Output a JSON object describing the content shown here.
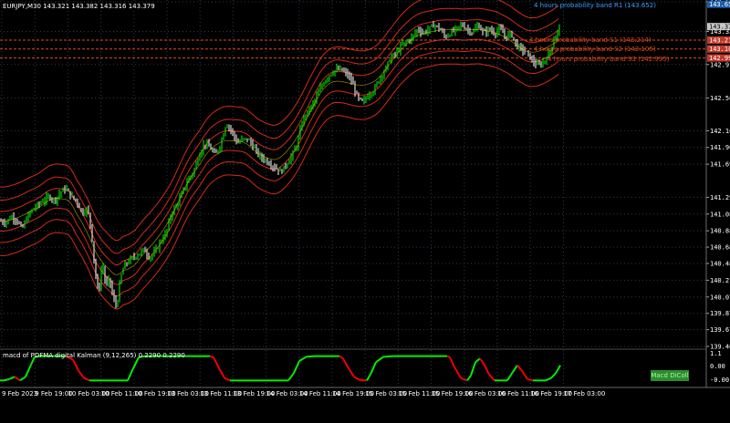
{
  "window": {
    "symbol_info": "EURJPY,M30  143.321 143.382 143.316 143.379",
    "indicator_info": "macd of PDFMA digital Kalman (9,12,265) 0.2290 0.2290",
    "macd_button": "Macd DiColl"
  },
  "colors": {
    "background": "#000000",
    "grid": "#2a3a4a",
    "bull_candle": "#00ff00",
    "bear_candle": "#ffffff",
    "kalman_line": "#ffe000",
    "band": "#d42a1a",
    "r1_text": "#3aa0ff",
    "s_text": "#e04a20",
    "macd_up": "#00ee00",
    "macd_down": "#ee0000",
    "macd_button_bg": "#2e8b2e"
  },
  "chart_data": [
    {
      "type": "candlestick",
      "title": "EURJPY,M30",
      "ylim": [
        139.465,
        143.682
      ],
      "price_ticks": [
        "143.682",
        "143.320",
        "142.915",
        "142.505",
        "142.105",
        "141.900",
        "141.695",
        "141.290",
        "141.085",
        "140.880",
        "140.680",
        "140.480",
        "140.275",
        "140.070",
        "139.870",
        "139.670",
        "139.465"
      ],
      "highlighted_price_labels": [
        {
          "label": "143.652",
          "kind": "r1"
        },
        {
          "label": "143.379",
          "kind": "current"
        },
        {
          "label": "143.214",
          "kind": "s"
        },
        {
          "label": "143.105",
          "kind": "s"
        },
        {
          "label": "142.995",
          "kind": "s"
        }
      ],
      "time_labels": [
        "9 Feb 2023",
        "9 Feb 19:00",
        "10 Feb 03:00",
        "10 Feb 11:00",
        "10 Feb 19:00",
        "13 Feb 03:00",
        "13 Feb 11:00",
        "13 Feb 19:00",
        "14 Feb 03:00",
        "14 Feb 11:00",
        "14 Feb 19:00",
        "15 Feb 03:00",
        "15 Feb 11:00",
        "15 Feb 19:00",
        "16 Feb 03:00",
        "16 Feb 11:00",
        "16 Feb 19:00",
        "17 Feb 03:00"
      ],
      "price_path": [
        [
          0,
          141.0
        ],
        [
          6,
          140.98
        ],
        [
          12,
          141.05
        ],
        [
          18,
          141.02
        ],
        [
          24,
          140.9
        ],
        [
          30,
          141.05
        ],
        [
          36,
          141.15
        ],
        [
          42,
          141.2
        ],
        [
          48,
          141.25
        ],
        [
          54,
          141.3
        ],
        [
          60,
          141.25
        ],
        [
          66,
          141.35
        ],
        [
          72,
          141.4
        ],
        [
          78,
          141.3
        ],
        [
          84,
          141.25
        ],
        [
          90,
          141.1
        ],
        [
          96,
          141.15
        ],
        [
          100,
          140.9
        ],
        [
          104,
          140.4
        ],
        [
          108,
          140.1
        ],
        [
          112,
          140.5
        ],
        [
          116,
          140.2
        ],
        [
          120,
          140.3
        ],
        [
          124,
          140.05
        ],
        [
          128,
          139.95
        ],
        [
          132,
          140.3
        ],
        [
          136,
          140.45
        ],
        [
          140,
          140.5
        ],
        [
          146,
          140.55
        ],
        [
          152,
          140.6
        ],
        [
          158,
          140.65
        ],
        [
          164,
          140.55
        ],
        [
          170,
          140.62
        ],
        [
          176,
          140.75
        ],
        [
          182,
          140.85
        ],
        [
          188,
          141.1
        ],
        [
          194,
          141.2
        ],
        [
          200,
          141.35
        ],
        [
          206,
          141.5
        ],
        [
          212,
          141.6
        ],
        [
          218,
          141.8
        ],
        [
          224,
          141.95
        ],
        [
          230,
          141.9
        ],
        [
          236,
          141.8
        ],
        [
          242,
          141.95
        ],
        [
          248,
          142.2
        ],
        [
          254,
          142.1
        ],
        [
          260,
          141.95
        ],
        [
          266,
          142.0
        ],
        [
          272,
          142.0
        ],
        [
          278,
          141.9
        ],
        [
          284,
          141.8
        ],
        [
          290,
          141.75
        ],
        [
          296,
          141.7
        ],
        [
          302,
          141.65
        ],
        [
          308,
          141.6
        ],
        [
          314,
          141.7
        ],
        [
          320,
          141.8
        ],
        [
          326,
          141.95
        ],
        [
          332,
          142.25
        ],
        [
          338,
          142.35
        ],
        [
          344,
          142.45
        ],
        [
          350,
          142.6
        ],
        [
          356,
          142.72
        ],
        [
          362,
          142.8
        ],
        [
          368,
          142.85
        ],
        [
          374,
          142.85
        ],
        [
          380,
          142.8
        ],
        [
          386,
          142.7
        ],
        [
          392,
          142.5
        ],
        [
          398,
          142.45
        ],
        [
          404,
          142.55
        ],
        [
          410,
          142.6
        ],
        [
          416,
          142.75
        ],
        [
          422,
          142.85
        ],
        [
          428,
          143.0
        ],
        [
          434,
          143.05
        ],
        [
          440,
          143.15
        ],
        [
          446,
          143.2
        ],
        [
          452,
          143.25
        ],
        [
          458,
          143.35
        ],
        [
          464,
          143.3
        ],
        [
          470,
          143.35
        ],
        [
          476,
          143.4
        ],
        [
          482,
          143.35
        ],
        [
          488,
          143.25
        ],
        [
          494,
          143.3
        ],
        [
          500,
          143.35
        ],
        [
          506,
          143.4
        ],
        [
          512,
          143.35
        ],
        [
          518,
          143.3
        ],
        [
          524,
          143.4
        ],
        [
          530,
          143.3
        ],
        [
          536,
          143.35
        ],
        [
          542,
          143.3
        ],
        [
          548,
          143.35
        ],
        [
          554,
          143.25
        ],
        [
          560,
          143.3
        ],
        [
          566,
          143.15
        ],
        [
          572,
          143.1
        ],
        [
          578,
          143.05
        ],
        [
          584,
          142.95
        ],
        [
          590,
          142.9
        ],
        [
          596,
          142.95
        ],
        [
          602,
          143.05
        ],
        [
          608,
          143.25
        ],
        [
          614,
          143.38
        ]
      ],
      "band_offsets": [
        0.12,
        0.26,
        0.42
      ],
      "band_labels": [
        {
          "text": "4 hours probability band R1 (143.652)",
          "kind": "r1"
        },
        {
          "text": "4 hours probability band S1 (143.214)",
          "kind": "s"
        },
        {
          "text": "4 hours probability band S2 (143.105)",
          "kind": "s"
        },
        {
          "text": "4 hours probability band S3 (142.995)",
          "kind": "s"
        }
      ]
    },
    {
      "type": "line",
      "title": "macd of PDFMA digital Kalman (9,12,265) 0.2290 0.2290",
      "ylim": [
        -0.1,
        1.1
      ],
      "y_ticks": [
        "1.1",
        "0.00",
        "-0.00"
      ],
      "path": [
        [
          0,
          0.0
        ],
        [
          4,
          0.0
        ],
        [
          10,
          0.05
        ],
        [
          16,
          0.15
        ],
        [
          22,
          0.0
        ],
        [
          28,
          0.15
        ],
        [
          34,
          0.65
        ],
        [
          38,
          0.97
        ],
        [
          44,
          1.0
        ],
        [
          60,
          1.0
        ],
        [
          72,
          1.0
        ],
        [
          80,
          0.85
        ],
        [
          86,
          0.4
        ],
        [
          92,
          0.1
        ],
        [
          98,
          0.0
        ],
        [
          110,
          0.0
        ],
        [
          125,
          0.0
        ],
        [
          140,
          0.0
        ],
        [
          146,
          0.5
        ],
        [
          152,
          0.95
        ],
        [
          158,
          1.0
        ],
        [
          180,
          1.0
        ],
        [
          200,
          1.0
        ],
        [
          215,
          1.0
        ],
        [
          230,
          1.0
        ],
        [
          234,
          0.95
        ],
        [
          240,
          0.5
        ],
        [
          246,
          0.1
        ],
        [
          252,
          0.0
        ],
        [
          270,
          0.0
        ],
        [
          300,
          0.0
        ],
        [
          316,
          0.0
        ],
        [
          322,
          0.3
        ],
        [
          328,
          0.8
        ],
        [
          336,
          0.98
        ],
        [
          345,
          1.0
        ],
        [
          360,
          1.0
        ],
        [
          372,
          1.0
        ],
        [
          376,
          0.9
        ],
        [
          382,
          0.5
        ],
        [
          388,
          0.15
        ],
        [
          394,
          0.02
        ],
        [
          402,
          0.0
        ],
        [
          406,
          0.25
        ],
        [
          412,
          0.75
        ],
        [
          420,
          0.97
        ],
        [
          430,
          1.0
        ],
        [
          460,
          1.0
        ],
        [
          490,
          1.0
        ],
        [
          493,
          0.95
        ],
        [
          498,
          0.55
        ],
        [
          505,
          0.1
        ],
        [
          512,
          0.0
        ],
        [
          516,
          0.2
        ],
        [
          521,
          0.75
        ],
        [
          526,
          0.9
        ],
        [
          530,
          0.7
        ],
        [
          536,
          0.25
        ],
        [
          542,
          0.0
        ],
        [
          552,
          0.0
        ],
        [
          556,
          0.0
        ],
        [
          562,
          0.35
        ],
        [
          567,
          0.62
        ],
        [
          572,
          0.4
        ],
        [
          578,
          0.05
        ],
        [
          584,
          0.0
        ],
        [
          598,
          0.0
        ],
        [
          604,
          0.1
        ],
        [
          609,
          0.3
        ],
        [
          614,
          0.62
        ]
      ]
    }
  ]
}
